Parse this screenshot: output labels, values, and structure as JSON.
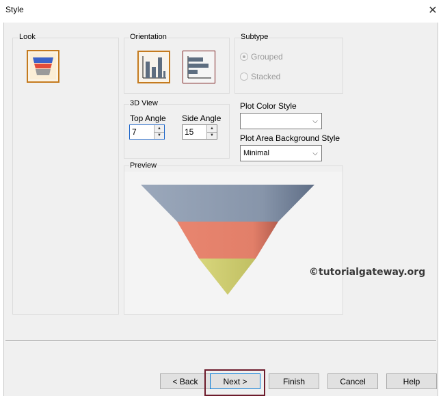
{
  "window": {
    "title": "Style",
    "close_glyph": "✕"
  },
  "look": {
    "label": "Look"
  },
  "orientation": {
    "label": "Orientation"
  },
  "subtype": {
    "label": "Subtype",
    "options": [
      {
        "label": "Grouped",
        "checked": true,
        "enabled": false
      },
      {
        "label": "Stacked",
        "checked": false,
        "enabled": false
      }
    ]
  },
  "view3d": {
    "label": "3D View",
    "top_angle_label": "Top Angle",
    "top_angle_value": "7",
    "side_angle_label": "Side Angle",
    "side_angle_value": "15"
  },
  "plot_color_style": {
    "label": "Plot Color Style",
    "value": ""
  },
  "plot_area_bg": {
    "label": "Plot Area Background Style",
    "value": "Minimal"
  },
  "preview": {
    "label": "Preview"
  },
  "watermark": "©tutorialgateway.org",
  "buttons": {
    "back": "< Back",
    "next": "Next >",
    "finish": "Finish",
    "cancel": "Cancel",
    "help": "Help"
  },
  "colors": {
    "funnel_top": "#8f9db1",
    "funnel_mid": "#e4806c",
    "funnel_bottom": "#d4d377",
    "accent_highlight": "#6d1b2b"
  }
}
